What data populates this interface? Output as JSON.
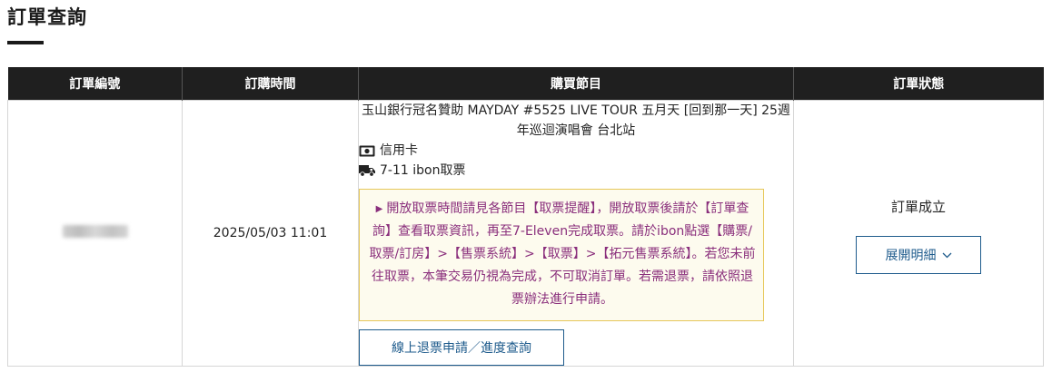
{
  "page": {
    "title": "訂單查詢"
  },
  "table": {
    "headers": [
      "訂單編號",
      "訂購時間",
      "購買節目",
      "訂單狀態"
    ],
    "rows": [
      {
        "order_time": "2025/05/03 11:01",
        "program_name": "玉山銀行冠名贊助 MAYDAY #5525 LIVE TOUR 五月天 [回到那一天] 25週年巡迴演唱會 台北站",
        "payment_method": "信用卡",
        "payment_icon": "cash-icon",
        "pickup_method": "7-11 ibon取票",
        "pickup_icon": "truck-icon",
        "notice": "開放取票時間請見各節目【取票提醒】，開放取票後請於【訂單查詢】查看取票資訊，再至7-Eleven完成取票。請於ibon點選【購票/取票/訂房】>【售票系統】>【取票】>【拓元售票系統】。若您未前往取票，本筆交易仍視為完成，不可取消訂單。若需退票，請依照退票辦法進行申請。",
        "refund_button": "線上退票申請／進度查詢",
        "status": "訂單成立",
        "expand_button": "展開明細"
      }
    ]
  },
  "colors": {
    "header_bg": "#1f1f1f",
    "notice_text": "#8a2f7c",
    "notice_border": "#e6c75a",
    "notice_bg": "#fdfbee",
    "button_accent": "#1e5b8c"
  }
}
